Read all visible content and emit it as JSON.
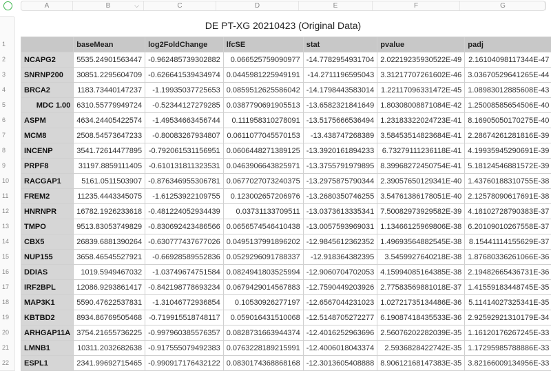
{
  "column_letters": [
    "A",
    "B",
    "C",
    "D",
    "E",
    "F",
    "G"
  ],
  "title": "DE PT-XG 20210423 (Original Data)",
  "headers": [
    "",
    "baseMean",
    "log2FoldChange",
    "lfcSE",
    "stat",
    "pvalue",
    "padj"
  ],
  "rows": [
    [
      "NCAPG2",
      "5535.24901563447",
      "-0.962485739302882",
      "0.066525759090977",
      "-14.7782954931704",
      "2.02219235930522E-49",
      "2.16104098117344E-47"
    ],
    [
      "SNRNP200",
      "30851.2295604709",
      "-0.626641539434974",
      "0.0445981225949191",
      "-14.2711196595043",
      "3.31217707261602E-46",
      "3.03670529641265E-44"
    ],
    [
      "BRCA2",
      "1183.73440147237",
      "-1.19935037725653",
      "0.0859512625586042",
      "-14.1798443583014",
      "1.22117096331472E-45",
      "1.08983012885608E-43"
    ],
    [
      "MDC 1.00",
      "6310.55779949724",
      "-0.52344127279285",
      "0.0387790691905513",
      "-13.6582321841649",
      "1.80308008871084E-42",
      "1.25008585654506E-40"
    ],
    [
      "ASPM",
      "4634.24405422574",
      "-1.49534663456744",
      "0.111958310278091",
      "-13.5175666536494",
      "1.23183322024723E-41",
      "8.16905050170275E-40"
    ],
    [
      "MCM8",
      "2508.54573647233",
      "-0.80083267934807",
      "0.0611077045570153",
      "-13.438747268389",
      "3.58453514823684E-41",
      "2.28674261281816E-39"
    ],
    [
      "INCENP",
      "3541.72614477895",
      "-0.792061531156951",
      "0.0606448271389125",
      "-13.3920161894233",
      "6.73279111236118E-41",
      "4.19935945290691E-39"
    ],
    [
      "PRPF8",
      "31197.8859111405",
      "-0.610131811323531",
      "0.0463906643825971",
      "-13.3755791979895",
      "8.39968272450754E-41",
      "5.18124546881572E-39"
    ],
    [
      "RACGAP1",
      "5161.0511503907",
      "-0.876346955306781",
      "0.0677027073240375",
      "-13.2975875790344",
      "2.39057650129341E-40",
      "1.43760188310755E-38"
    ],
    [
      "FREM2",
      "11235.4443345075",
      "-1.61253922109755",
      "0.123002657206976",
      "-13.2680350746255",
      "3.54761386178051E-40",
      "2.12578090617691E-38"
    ],
    [
      "HNRNPR",
      "16782.1926233618",
      "-0.481224052934439",
      "0.03731133709511",
      "-13.0373613335341",
      "7.50082973929582E-39",
      "4.18102728790383E-37"
    ],
    [
      "TMPO",
      "9513.83053749829",
      "-0.830692423486566",
      "0.0656574546410438",
      "-13.0057593969031",
      "1.13466125969806E-38",
      "6.20109010267558E-37"
    ],
    [
      "CBX5",
      "26839.6881390264",
      "-0.630777437677026",
      "0.0495137991896202",
      "-12.9845612362352",
      "1.49693564882545E-38",
      "8.15441114155629E-37"
    ],
    [
      "NUP155",
      "3658.46545527921",
      "-0.66928589552836",
      "0.0529296091788337",
      "-12.918364382395",
      "3.5459927640218E-38",
      "1.87680336261066E-36"
    ],
    [
      "DDIAS",
      "1019.5949467032",
      "-1.03749674751584",
      "0.0824941803525994",
      "-12.9060704702053",
      "4.15994085164385E-38",
      "2.19482665436731E-36"
    ],
    [
      "IRF2BPL",
      "12086.9293861417",
      "-0.842198778693234",
      "0.0679429014567883",
      "-12.7590449203926",
      "2.77583569881018E-37",
      "1.41559183448745E-35"
    ],
    [
      "MAP3K1",
      "5590.47622537831",
      "-1.31046772936854",
      "0.10530926277197",
      "-12.6567044231023",
      "1.02721735134486E-36",
      "5.11414027325341E-35"
    ],
    [
      "KBTBD2",
      "8934.86769505468",
      "-0.719915518748117",
      "0.059016431510068",
      "-12.5148705272277",
      "6.19087418435533E-36",
      "2.92592921310179E-34"
    ],
    [
      "ARHGAP11A",
      "3754.21655736225",
      "-0.997960385576357",
      "0.0828731663944374",
      "-12.4016252963696",
      "2.56076202282039E-35",
      "1.16120176267245E-33"
    ],
    [
      "LMNB1",
      "10311.2032682638",
      "-0.917555079492383",
      "0.0763228189215991",
      "-12.4006018043374",
      "2.5936828422742E-35",
      "1.17295985788886E-33"
    ],
    [
      "ESPL1",
      "2341.99692715465",
      "-0.990917176432122",
      "0.0830174368868168",
      "-12.3013605408888",
      "8.90612168147383E-35",
      "3.82166009134956E-33"
    ]
  ]
}
